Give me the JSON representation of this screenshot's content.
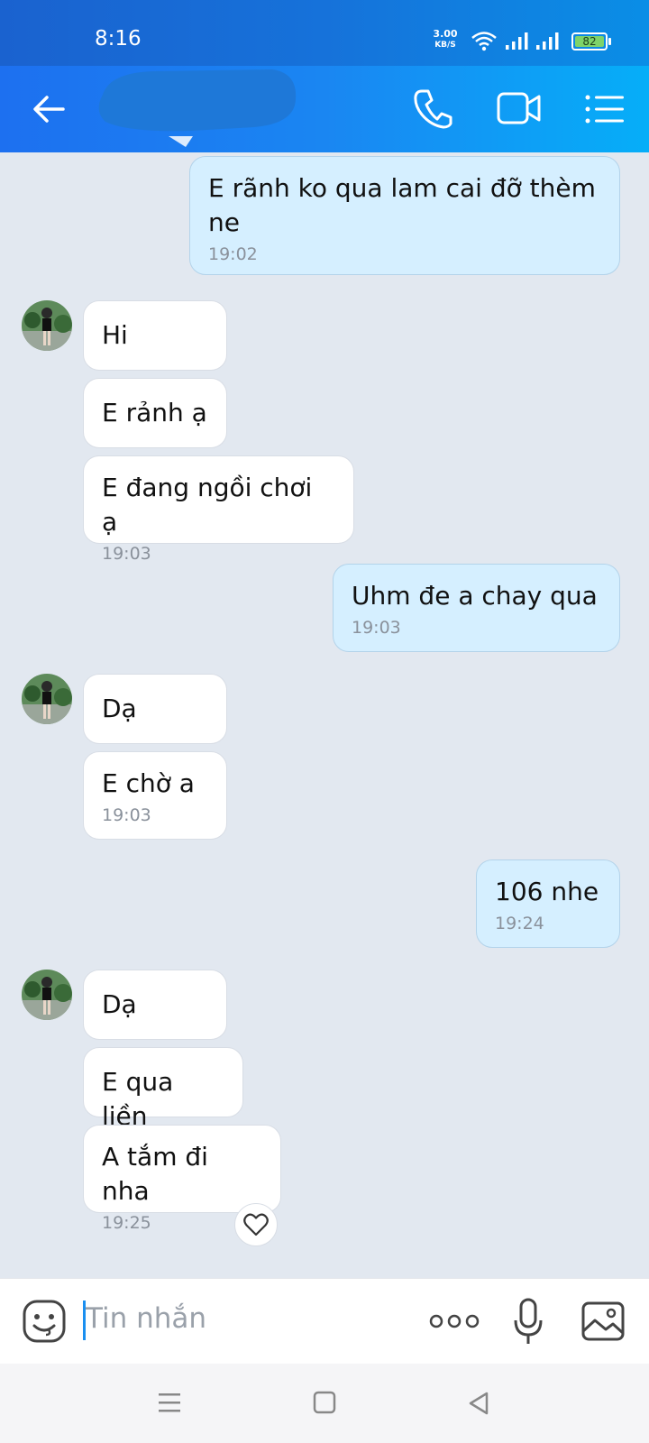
{
  "status_bar": {
    "time": "8:16",
    "net_speed_value": "3.00",
    "net_speed_unit": "KB/S",
    "battery": "82",
    "icons": [
      "wifi-icon",
      "signal-icon",
      "signal-icon",
      "battery-icon"
    ]
  },
  "header": {
    "icons": [
      "back-arrow-icon",
      "phone-icon",
      "video-camera-icon",
      "menu-list-icon"
    ],
    "contact_name_redacted": true,
    "accent_color": "#1a7cf0"
  },
  "messages": [
    {
      "id": "m1",
      "side": "out",
      "text": "E rãnh ko qua lam cai đỡ thèm ne",
      "time": "19:02"
    },
    {
      "id": "m2",
      "side": "in",
      "text": "Hi",
      "time": ""
    },
    {
      "id": "m3",
      "side": "in",
      "text": "E rảnh ạ",
      "time": ""
    },
    {
      "id": "m4",
      "side": "in",
      "text": "E đang ngồi chơi ạ",
      "time": "19:03"
    },
    {
      "id": "m5",
      "side": "out",
      "text": "Uhm đe a chay qua",
      "time": "19:03"
    },
    {
      "id": "m6",
      "side": "in",
      "text": "Dạ",
      "time": ""
    },
    {
      "id": "m7",
      "side": "in",
      "text": "E chờ a",
      "time": "19:03"
    },
    {
      "id": "m8",
      "side": "out",
      "text": "106 nhe",
      "time": "19:24"
    },
    {
      "id": "m9",
      "side": "in",
      "text": "Dạ",
      "time": ""
    },
    {
      "id": "m10",
      "side": "in",
      "text": "E qua liền",
      "time": ""
    },
    {
      "id": "m11",
      "side": "in",
      "text": "A tắm đi nha",
      "time": "19:25"
    }
  ],
  "composer": {
    "placeholder": "Tin nhắn",
    "icons": [
      "emoji-icon",
      "more-dots-icon",
      "microphone-icon",
      "image-icon"
    ]
  },
  "nav_bar": {
    "icons": [
      "menu-icon",
      "home-icon",
      "back-triangle-icon"
    ]
  },
  "colors": {
    "incoming_bubble": "#ffffff",
    "outgoing_bubble": "#d5efff",
    "chat_background": "#e2e8f0"
  }
}
